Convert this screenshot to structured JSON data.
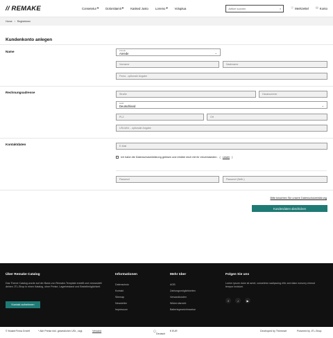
{
  "header": {
    "logo": "// REMAKE",
    "nav": [
      "Consetetur",
      "Dolorsitamit",
      "Kasked Justo",
      "Loremo",
      "Voluptua"
    ],
    "search_placeholder": "Artikel suchen",
    "wishlist": "Merkzettel",
    "account": "Konto"
  },
  "breadcrumb": [
    "Home",
    "Registrieren"
  ],
  "page_title": "Kundenkonto anlegen",
  "name": {
    "label": "Name",
    "salutation_label": "Anrede",
    "salutation_value": "Anrede",
    "first": "Vorname",
    "last": "Nachname",
    "company": "Firma - optionale Angabe"
  },
  "address": {
    "label": "Rechnungsadresse",
    "street": "Straße",
    "number": "Hausnummer",
    "country_label": "Land",
    "country_value": "Deutschland",
    "zip": "PLZ",
    "city": "Ort",
    "vat": "USt-IdNr. - optionale Angabe"
  },
  "contact": {
    "label": "Kontaktdaten",
    "email": "E-Mail",
    "privacy_text": "Ich habe die Datenschutzerklärung gelesen und erkläre mich mit ihr einverstanden.",
    "privacy_link": "Lesen",
    "password": "Passwort",
    "password_repeat": "Passwort (Wdh.)"
  },
  "privacy_note": "Bitte beachten Sie unsere Datenschutzerklärung",
  "submit": "Kundendaten abschicken",
  "footer": {
    "about_title": "Über Remake Catalog",
    "about_text": "Das Theme Catalog wurde auf der Basis von Remake-Template erstellt und verwandelt deinen JTL-Shop in einen Katalog, ohne Preise, Lagerbestand und Bestellmöglichkeit.",
    "contact_button": "Kontakt aufnehmen",
    "info_title": "Informationen",
    "info_links": [
      "Datenschutz",
      "Kontakt",
      "Sitemap",
      "Newsletter",
      "Impressum"
    ],
    "more_title": "Mehr über",
    "more_links": [
      "AGB",
      "Zahlungsmöglichkeiten",
      "Versandkosten",
      "Widerrufsrecht",
      "Batteriegesetzhinweise"
    ],
    "follow_title": "Folgen Sie uns",
    "follow_text": "Lorem ipsum dolor sit amet, consetetur sadipscing elitr, sed diam nonumy eirmod tempor invidunt.",
    "social": [
      "f",
      "♪",
      "▶"
    ]
  },
  "bottom": {
    "copyright": "© MusterFirma GmbH",
    "tax_note": "* Alle Preise inkl. gesetzlicher USt., zzgl.",
    "shipping_link": "Versand",
    "language": "Deutsch",
    "currency": "€ EUR",
    "developed": "Developed by Themeart",
    "powered": "Powered by JTL-Shop"
  }
}
